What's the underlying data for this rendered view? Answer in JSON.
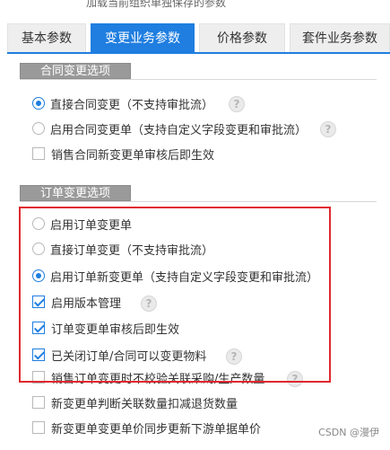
{
  "header_hint": "加载当前组织单独保存的参数",
  "tabs": [
    {
      "label": "基本参数",
      "active": false
    },
    {
      "label": "变更业务参数",
      "active": true
    },
    {
      "label": "价格参数",
      "active": false
    },
    {
      "label": "套件业务参数",
      "active": false
    }
  ],
  "sections": {
    "contract": {
      "title": "合同变更选项",
      "options": [
        {
          "label": "直接合同变更（不支持审批流）",
          "type": "radio",
          "checked": true,
          "help": true
        },
        {
          "label": "启用合同变更单（支持自定义字段变更和审批流）",
          "type": "radio",
          "checked": false,
          "help": true
        },
        {
          "label": "销售合同新变更单审核后即生效",
          "type": "checkbox",
          "checked": false,
          "help": false
        }
      ]
    },
    "order": {
      "title": "订单变更选项",
      "options": [
        {
          "label": "启用订单变更单",
          "type": "radio",
          "checked": false,
          "help": false
        },
        {
          "label": "直接订单变更（不支持审批流）",
          "type": "radio",
          "checked": false,
          "help": false
        },
        {
          "label": "启用订单新变更单（支持自定义字段变更和审批流）",
          "type": "radio",
          "checked": true,
          "help": false
        },
        {
          "label": "启用版本管理",
          "type": "checkbox",
          "checked": true,
          "help": true
        },
        {
          "label": "订单变更单审核后即生效",
          "type": "checkbox",
          "checked": true,
          "help": false
        },
        {
          "label": "已关闭订单/合同可以变更物料",
          "type": "checkbox",
          "checked": true,
          "help": true
        },
        {
          "label": "销售订单变更时不校验关联采购/生产数量",
          "type": "checkbox",
          "checked": false,
          "help": true
        },
        {
          "label": "新变更单判断关联数量扣减退货数量",
          "type": "checkbox",
          "checked": false,
          "help": false
        },
        {
          "label": "新变更单变更单价同步更新下游单据单价",
          "type": "checkbox",
          "checked": false,
          "help": false
        }
      ]
    }
  },
  "watermark": "CSDN @漫伊",
  "colors": {
    "accent": "#1f7ee0",
    "highlight_box": "#e0282e",
    "section_title_bg": "#9a9a9a"
  }
}
